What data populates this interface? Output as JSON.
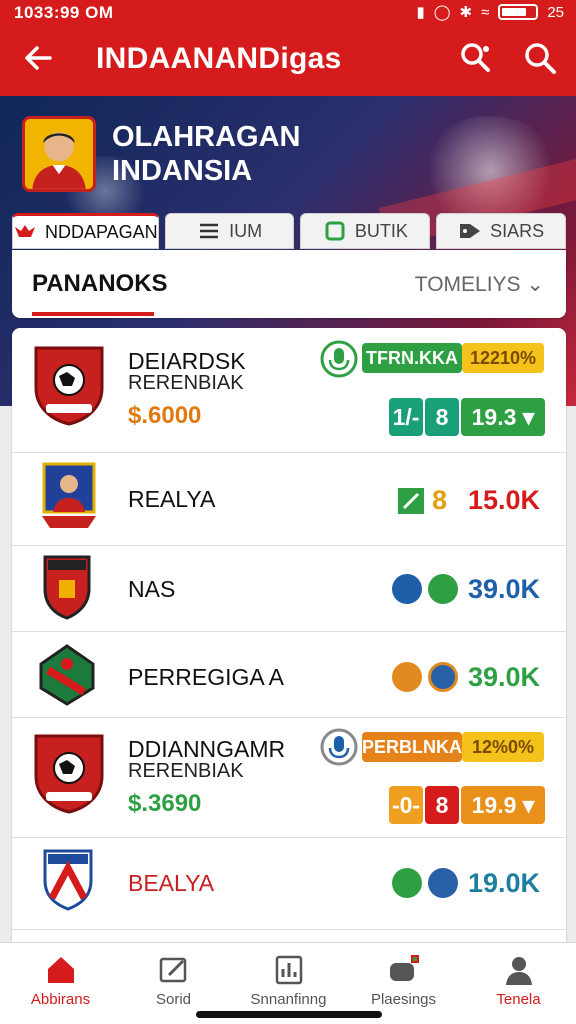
{
  "status_bar": {
    "time": "1033:99 OM",
    "battery_text": "25"
  },
  "app_bar": {
    "title": "INDAANANDigas"
  },
  "hero": {
    "title_line1": "OLAHRAGAN",
    "title_line2": "INDANSIA"
  },
  "tabs": [
    {
      "label": "NDDAPAGAN",
      "icon": "eagle-icon",
      "active": true
    },
    {
      "label": "IUM",
      "icon": "list-icon",
      "active": false
    },
    {
      "label": "BUTIK",
      "icon": "shop-icon",
      "active": false
    },
    {
      "label": "SIARS",
      "icon": "tag-icon",
      "active": false
    }
  ],
  "section": {
    "label": "PANANOKS",
    "sort_label": "TOMELIYS"
  },
  "rows": [
    {
      "name": "DEIARDSK",
      "sub": "RERENBIAK",
      "price": "$.6000",
      "badge_label": "TFRN.KKA",
      "badge_pct": "12210%",
      "chips": [
        "1/-",
        "8",
        "19.3"
      ]
    },
    {
      "name": "REALYA",
      "chips": [
        "8"
      ],
      "value": "15.0K"
    },
    {
      "name": "NAS",
      "value": "39.0K"
    },
    {
      "name": "PERREGIGA A",
      "value": "39.0K"
    },
    {
      "name": "DDIANNGAMR",
      "sub": "RERENBIAK",
      "price": "$.3690",
      "badge_label": "PERBLNKA",
      "badge_pct": "12%0%",
      "chips": [
        "-0-",
        "8",
        "19.9"
      ]
    },
    {
      "name": "BEALYA",
      "value": "19.0K"
    }
  ],
  "bottom_nav": [
    {
      "label": "Abbirans",
      "icon": "home-icon",
      "active": true
    },
    {
      "label": "Sorid",
      "icon": "edit-icon",
      "active": false
    },
    {
      "label": "Snnanfinng",
      "icon": "ranking-icon",
      "active": false
    },
    {
      "label": "Plaesings",
      "icon": "game-icon",
      "active": false
    },
    {
      "label": "Tenela",
      "icon": "profile-icon",
      "active": false
    }
  ],
  "colors": {
    "primary": "#d51b1b",
    "green": "#2ea043",
    "amber": "#f0a020",
    "blue": "#1d5fa8"
  }
}
